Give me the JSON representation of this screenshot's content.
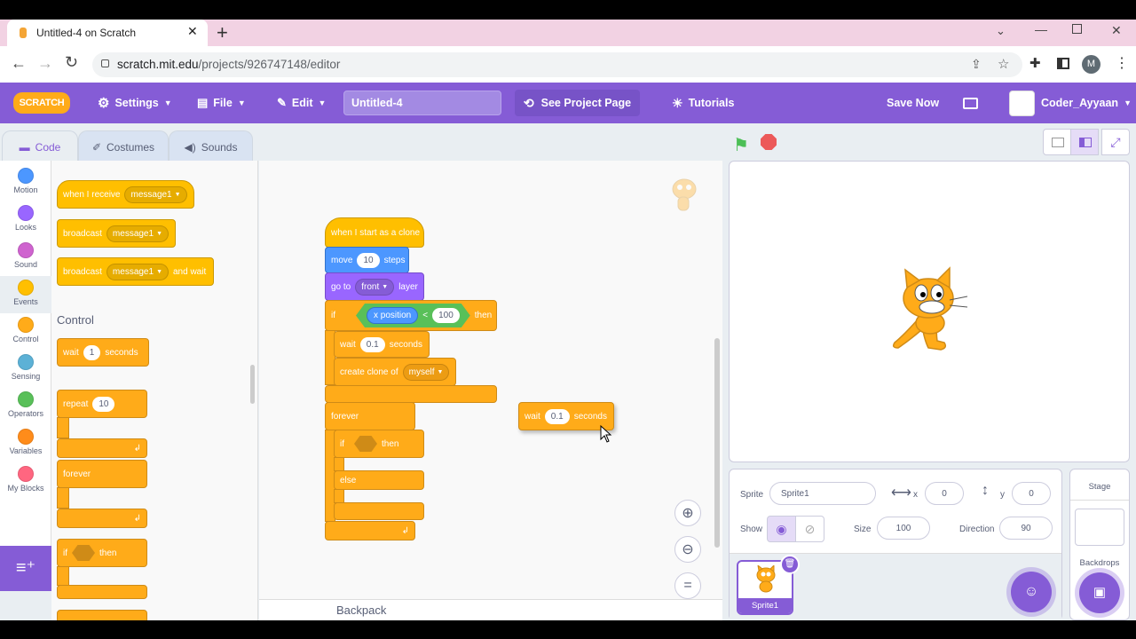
{
  "browser": {
    "tab_title": "Untitled-4 on Scratch",
    "url_host": "scratch.mit.edu",
    "url_path": "/projects/926747148/editor",
    "profile_initial": "M"
  },
  "menu": {
    "settings": "Settings",
    "file": "File",
    "edit": "Edit",
    "project_title_value": "Untitled-4",
    "see_project_page": "See Project Page",
    "tutorials": "Tutorials",
    "save_now": "Save Now",
    "username": "Coder_Ayyaan"
  },
  "editor_tabs": {
    "code": "Code",
    "costumes": "Costumes",
    "sounds": "Sounds"
  },
  "categories": [
    {
      "label": "Motion",
      "color": "#4c97ff"
    },
    {
      "label": "Looks",
      "color": "#9966ff"
    },
    {
      "label": "Sound",
      "color": "#cf63cf"
    },
    {
      "label": "Events",
      "color": "#ffbf00"
    },
    {
      "label": "Control",
      "color": "#ffab19"
    },
    {
      "label": "Sensing",
      "color": "#5cb1d6"
    },
    {
      "label": "Operators",
      "color": "#59c059"
    },
    {
      "label": "Variables",
      "color": "#ff8c1a"
    },
    {
      "label": "My Blocks",
      "color": "#ff6680"
    }
  ],
  "palette": {
    "when_i_receive": "when I receive",
    "message1": "message1",
    "broadcast": "broadcast",
    "and_wait": "and wait",
    "control_heading": "Control",
    "wait": "wait",
    "wait_value": "1",
    "seconds": "seconds",
    "repeat": "repeat",
    "repeat_value": "10",
    "forever": "forever",
    "if": "if",
    "then": "then"
  },
  "script": {
    "hat": "when I start as a clone",
    "move": "move",
    "move_value": "10",
    "steps": "steps",
    "go_to": "go to",
    "front": "front",
    "layer": "layer",
    "if": "if",
    "x_position": "x position",
    "lt": "<",
    "lt_value": "100",
    "then": "then",
    "wait": "wait",
    "wait_value": "0.1",
    "seconds": "seconds",
    "create_clone_of": "create clone of",
    "myself": "myself",
    "forever": "forever",
    "else": "else",
    "floating_wait": "wait",
    "floating_wait_value": "0.1",
    "floating_seconds": "seconds"
  },
  "backpack": "Backpack",
  "sprite_info": {
    "sprite_label": "Sprite",
    "sprite_name": "Sprite1",
    "x_label": "x",
    "x_value": "0",
    "y_label": "y",
    "y_value": "0",
    "show_label": "Show",
    "size_label": "Size",
    "size_value": "100",
    "direction_label": "Direction",
    "direction_value": "90",
    "thumb_name": "Sprite1"
  },
  "stage_panel": {
    "stage": "Stage",
    "backdrops": "Backdrops"
  },
  "colors": {
    "scratch_purple": "#855cd6",
    "control": "#ffab19",
    "events": "#ffbf00",
    "motion": "#4c97ff",
    "looks": "#9966ff",
    "operators": "#59c059"
  }
}
